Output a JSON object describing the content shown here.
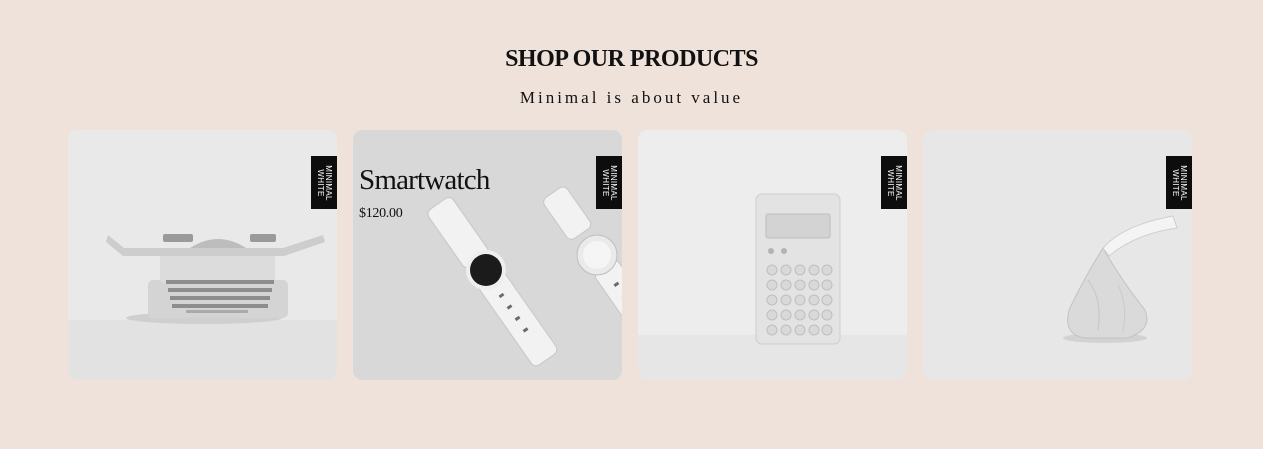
{
  "section": {
    "title": "SHOP OUR PRODUCTS",
    "subtitle": "Minimal is about value"
  },
  "products": [
    {
      "image": "typewriter-image",
      "badge_line1": "MINIMAL",
      "badge_line2": "WHITE",
      "bg": "#e8e8e8"
    },
    {
      "image": "smartwatch-image",
      "badge_line1": "MINIMAL",
      "badge_line2": "WHITE",
      "bg": "#d6d6d6",
      "name": "Smartwatch",
      "price": "$120.00"
    },
    {
      "image": "calculator-image",
      "badge_line1": "MINIMAL",
      "badge_line2": "WHITE",
      "bg": "#ececec"
    },
    {
      "image": "kiss-candy-image",
      "badge_line1": "MINIMAL",
      "badge_line2": "WHITE",
      "bg": "#e6e6e6"
    }
  ],
  "colors": {
    "page_bg": "#efe2db",
    "badge_bg": "#0d0d0d",
    "text": "#111111"
  }
}
